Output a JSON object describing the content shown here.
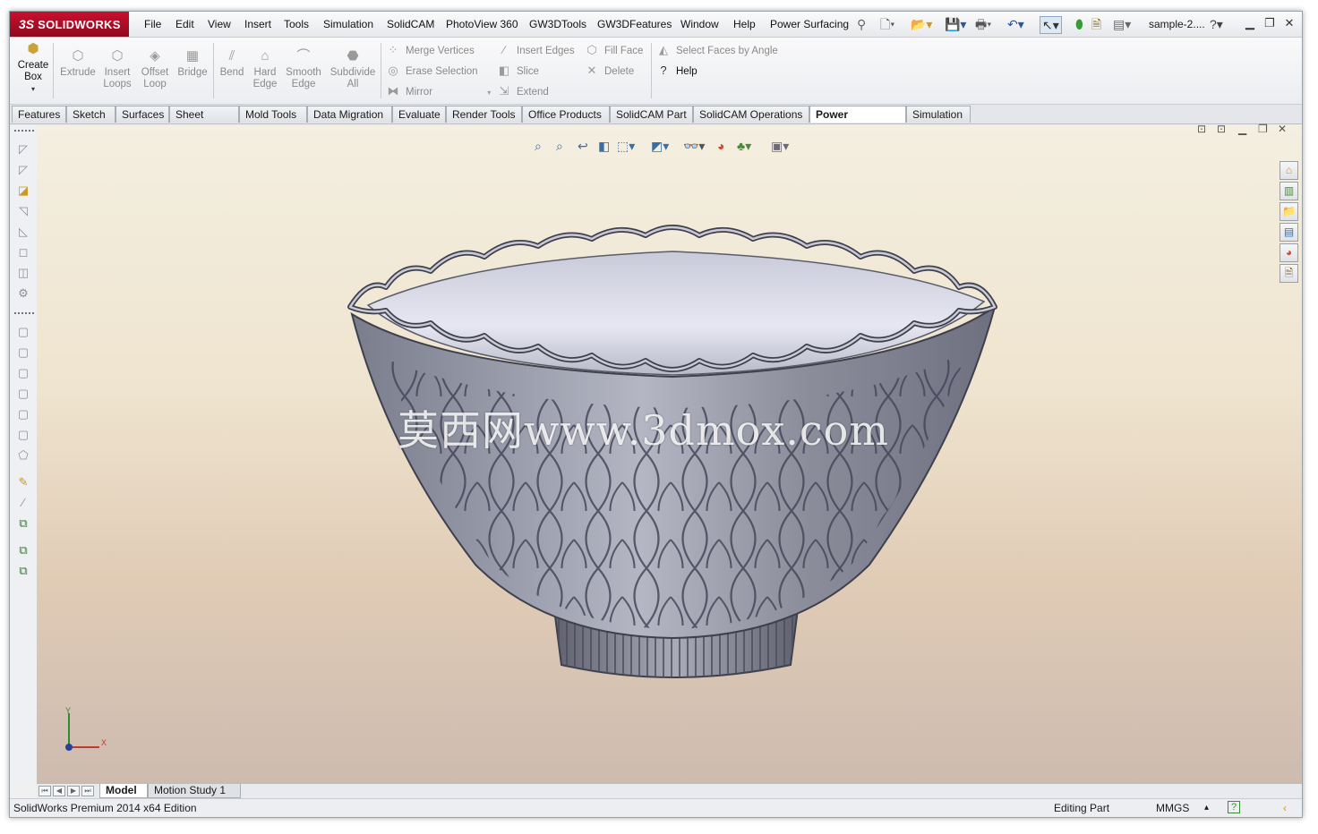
{
  "app": {
    "logo_ds": "3S",
    "logo_name": "SOLIDWORKS",
    "doc_title": "sample-2...."
  },
  "menu": [
    "File",
    "Edit",
    "View",
    "Insert",
    "Tools",
    "Simulation",
    "SolidCAM",
    "PhotoView 360",
    "GW3DTools",
    "GW3DFeatures",
    "Window",
    "Help",
    "Power Surfacing"
  ],
  "command_manager": {
    "create_box": {
      "line1": "Create",
      "line2": "Box",
      "icon": "cube-icon"
    },
    "big_buttons": [
      {
        "line1": "Extrude",
        "line2": "",
        "icon": "extrude-icon"
      },
      {
        "line1": "Insert",
        "line2": "Loops",
        "icon": "insert-loops-icon"
      },
      {
        "line1": "Offset",
        "line2": "Loop",
        "icon": "offset-loop-icon"
      },
      {
        "line1": "Bridge",
        "line2": "",
        "icon": "bridge-icon"
      },
      {
        "line1": "Bend",
        "line2": "",
        "icon": "bend-icon"
      },
      {
        "line1": "Hard",
        "line2": "Edge",
        "icon": "hard-edge-icon"
      },
      {
        "line1": "Smooth",
        "line2": "Edge",
        "icon": "smooth-edge-icon"
      },
      {
        "line1": "Subdivide",
        "line2": "All",
        "icon": "subdivide-icon"
      }
    ],
    "small_buttons": [
      {
        "label": "Merge Vertices",
        "icon": "merge-vertices-icon"
      },
      {
        "label": "Erase Selection",
        "icon": "erase-selection-icon"
      },
      {
        "label": "Mirror",
        "icon": "mirror-icon"
      },
      {
        "label": "Insert Edges",
        "icon": "insert-edges-icon"
      },
      {
        "label": "Slice",
        "icon": "slice-icon"
      },
      {
        "label": "Extend",
        "icon": "extend-icon"
      },
      {
        "label": "Fill Face",
        "icon": "fill-face-icon"
      },
      {
        "label": "Delete",
        "icon": "delete-icon"
      },
      {
        "label": "Select Faces by Angle",
        "icon": "select-faces-icon"
      },
      {
        "label": "Help",
        "icon": "help-icon"
      }
    ]
  },
  "tabs": [
    "Features",
    "Sketch",
    "Surfaces",
    "Sheet Metal",
    "Mold Tools",
    "Data Migration",
    "Evaluate",
    "Render Tools",
    "Office Products",
    "SolidCAM Part",
    "SolidCAM Operations",
    "Power Surfacing",
    "Simulation"
  ],
  "selected_tab": "Power Surfacing",
  "viewport": {
    "watermark": "莫西网www.3dmox.com",
    "triad": {
      "x": "X",
      "y": "Y"
    }
  },
  "bottom_tabs": [
    "Model",
    "Motion Study 1"
  ],
  "status": {
    "edition": "SolidWorks Premium 2014 x64 Edition",
    "mode": "Editing Part",
    "units": "MMGS",
    "units_arrow": "▴",
    "help": "?"
  },
  "colors": {
    "brand_red": "#c8102e",
    "viewport_top": "#f4efe1",
    "viewport_bottom": "#cdbbb0",
    "model_gray": "#7d8090"
  }
}
